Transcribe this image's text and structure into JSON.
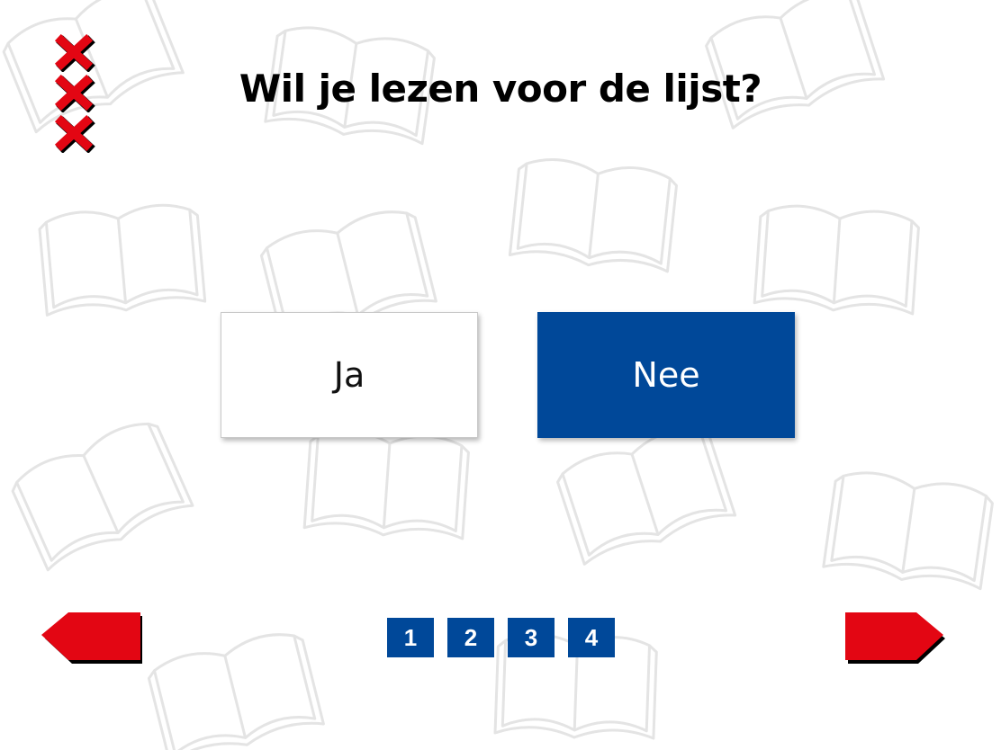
{
  "title": "Wil je lezen voor de lijst?",
  "answers": {
    "yes_label": "Ja",
    "no_label": "Nee"
  },
  "pagination": {
    "pages": [
      "1",
      "2",
      "3",
      "4"
    ]
  },
  "icons": {
    "logo": "amsterdam-xxx-logo-icon",
    "prev": "arrow-left-icon",
    "next": "arrow-right-icon",
    "background": "open-book-icon"
  },
  "colors": {
    "primary_blue": "#004899",
    "accent_red": "#e30613",
    "background": "#ffffff"
  }
}
